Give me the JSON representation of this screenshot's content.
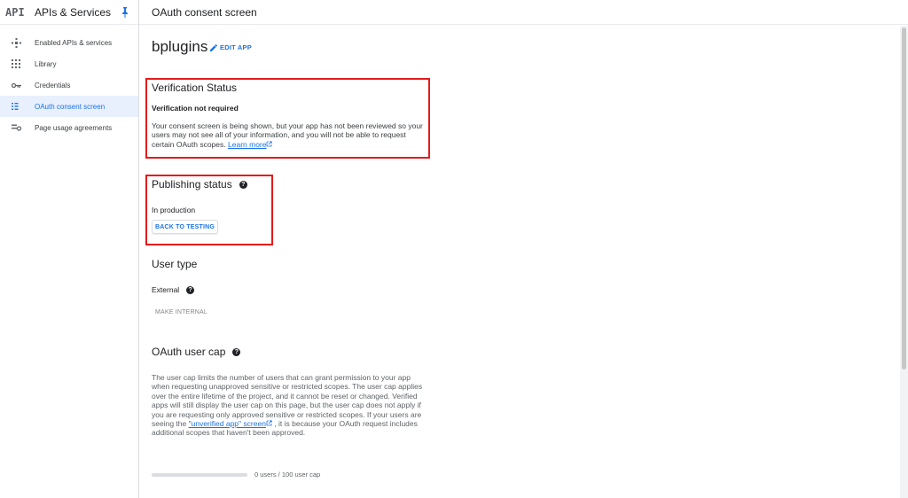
{
  "sidebar": {
    "logo": "API",
    "title": "APIs & Services",
    "items": [
      {
        "label": "Enabled APIs & services",
        "icon": "diamond-icon",
        "active": false
      },
      {
        "label": "Library",
        "icon": "library-grid-icon",
        "active": false
      },
      {
        "label": "Credentials",
        "icon": "key-icon",
        "active": false
      },
      {
        "label": "OAuth consent screen",
        "icon": "consent-list-icon",
        "active": true
      },
      {
        "label": "Page usage agreements",
        "icon": "settings-list-icon",
        "active": false
      }
    ]
  },
  "topbar": {
    "title": "OAuth consent screen"
  },
  "app": {
    "name": "bplugins",
    "edit_label": "EDIT APP"
  },
  "verification": {
    "heading": "Verification Status",
    "status": "Verification not required",
    "description": "Your consent screen is being shown, but your app has not been reviewed so your users may not see all of your information, and you will not be able to request certain OAuth scopes.",
    "learn_more": "Learn more"
  },
  "publishing": {
    "heading": "Publishing status",
    "status": "In production",
    "button": "BACK TO TESTING"
  },
  "user_type": {
    "heading": "User type",
    "value": "External",
    "button": "MAKE INTERNAL"
  },
  "user_cap": {
    "heading": "OAuth user cap",
    "description_before": "The user cap limits the number of users that can grant permission to your app when requesting unapproved sensitive or restricted scopes. The user cap applies over the entire lifetime of the project, and it cannot be reset or changed. Verified apps will still display the user cap on this page, but the user cap does not apply if you are requesting only approved sensitive or restricted scopes. If your users are seeing the",
    "link": "\"unverified app\" screen",
    "description_after": ", it is because your OAuth request includes additional scopes that haven't been approved.",
    "count_text": "0 users / 100 user cap",
    "used": 0,
    "cap": 100
  },
  "colors": {
    "accent": "#1a73e8",
    "highlight": "#e41b1b",
    "active_bg": "#e8f0fe"
  }
}
